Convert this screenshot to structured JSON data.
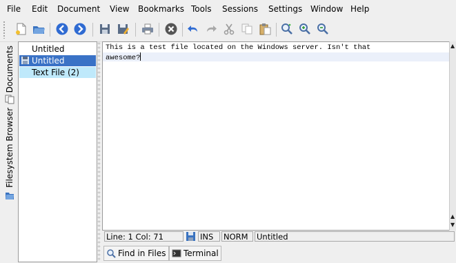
{
  "menu": [
    "File",
    "Edit",
    "Document",
    "View",
    "Bookmarks",
    "Tools",
    "Sessions",
    "Settings",
    "Window",
    "Help"
  ],
  "toolbar": {
    "icons": [
      "new-document-icon",
      "open-folder-icon",
      "back-icon",
      "forward-icon",
      "save-icon",
      "save-as-icon",
      "print-icon",
      "close-icon",
      "undo-icon",
      "redo-icon",
      "cut-icon",
      "copy-icon",
      "paste-icon",
      "find-icon",
      "zoom-in-icon",
      "zoom-out-icon"
    ]
  },
  "sidetabs": {
    "documents": "Documents",
    "filesystem": "Filesystem Browser"
  },
  "documents": [
    {
      "label": "Untitled",
      "selected": false,
      "modified": false
    },
    {
      "label": "Untitled",
      "selected": true,
      "modified": true
    },
    {
      "label": "Text File (2)",
      "selected": false,
      "modified": false
    }
  ],
  "editor": {
    "lines": [
      "This is a test file located on the Windows server. Isn't that",
      "awesome?"
    ]
  },
  "status": {
    "position": "Line: 1 Col: 71",
    "ins": "INS",
    "mode": "NORM",
    "doc": "Untitled"
  },
  "bottom_tabs": [
    "Find in Files",
    "Terminal"
  ],
  "colors": {
    "selection": "#3a72c6",
    "doc_highlight": "#bfe9fb",
    "current_line": "#ebf0fa"
  }
}
